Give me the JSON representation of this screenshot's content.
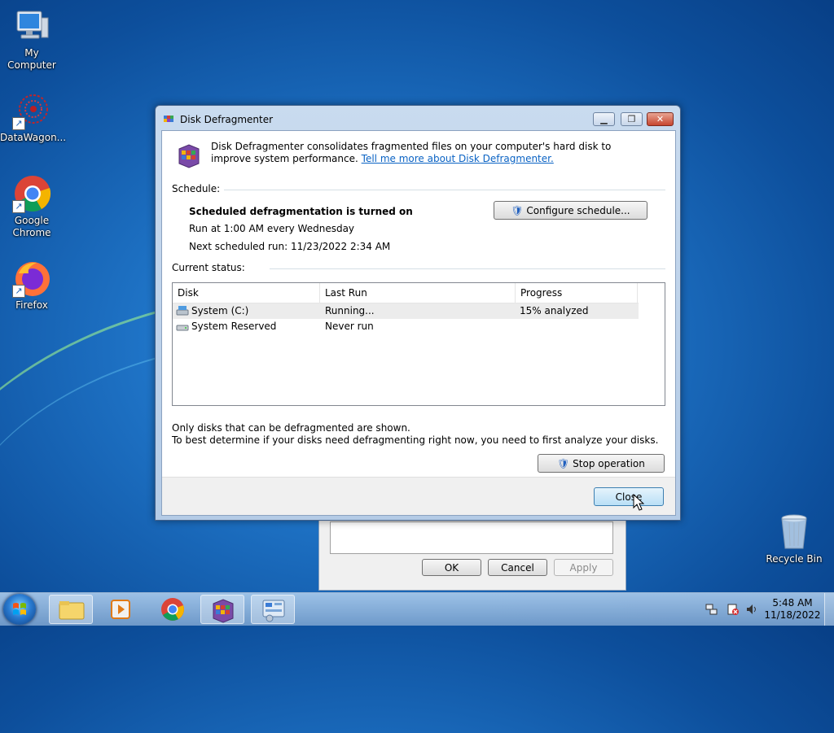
{
  "desktop": {
    "icons": [
      {
        "label": "My Computer"
      },
      {
        "label": "DataWagon..."
      },
      {
        "label": "Google Chrome"
      },
      {
        "label": "Firefox"
      },
      {
        "label": "Recycle Bin"
      }
    ]
  },
  "background_dialog": {
    "ok_label": "OK",
    "cancel_label": "Cancel",
    "apply_label": "Apply"
  },
  "window": {
    "title": "Disk Defragmenter",
    "description": "Disk Defragmenter consolidates fragmented files on your computer's hard disk to improve system performance.",
    "learn_more_link": "Tell me more about Disk Defragmenter.",
    "schedule": {
      "heading": "Schedule:",
      "status": "Scheduled defragmentation is turned on",
      "run_at": "Run at 1:00 AM every Wednesday",
      "next_run": "Next scheduled run: 11/23/2022 2:34 AM",
      "configure_label": "Configure schedule..."
    },
    "current_status": {
      "heading": "Current status:",
      "columns": [
        "Disk",
        "Last Run",
        "Progress"
      ],
      "rows": [
        {
          "disk": "System (C:)",
          "last_run": "Running...",
          "progress": "15% analyzed"
        },
        {
          "disk": "System Reserved",
          "last_run": "Never run",
          "progress": ""
        }
      ]
    },
    "notes": {
      "line1": "Only disks that can be defragmented are shown.",
      "line2": "To best determine if your disks need defragmenting right now, you need to first analyze your disks."
    },
    "stop_label": "Stop operation",
    "close_label": "Close"
  },
  "taskbar": {
    "clock": {
      "time": "5:48 AM",
      "date": "11/18/2022"
    }
  }
}
